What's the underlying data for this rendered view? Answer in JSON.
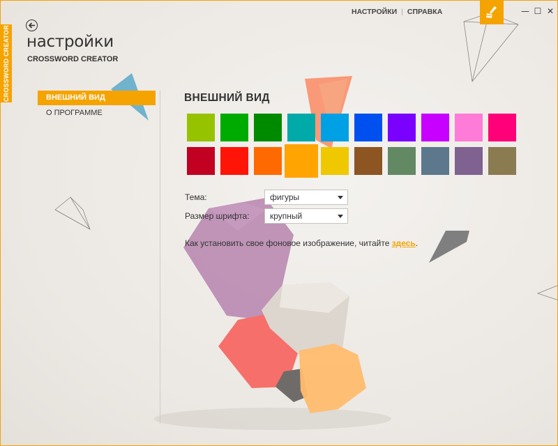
{
  "side_tab": {
    "label": "CROSSWORD CREATOR"
  },
  "top_links": {
    "settings": "НАСТРОЙКИ",
    "help": "СПРАВКА"
  },
  "window_controls": {
    "minimize": "—",
    "maximize": "☐",
    "close": "✕"
  },
  "header": {
    "title": "настройки",
    "subtitle": "CROSSWORD CREATOR"
  },
  "nav": {
    "items": [
      {
        "label": "ВНЕШНИЙ ВИД",
        "active": true
      },
      {
        "label": "О ПРОГРАММЕ",
        "active": false
      }
    ]
  },
  "main": {
    "section_title": "ВНЕШНИЙ ВИД",
    "selected_color": "#ffa400",
    "colors_row1": [
      "#96c300",
      "#00ab00",
      "#008a00",
      "#00aaa8",
      "#00a1e4",
      "#0050ef",
      "#7a00ff",
      "#c800ff",
      "#ff7bd8",
      "#ff0078"
    ],
    "colors_row2": [
      "#c10022",
      "#ff1508",
      "#ff6a00",
      "#ffa400",
      "#efc800",
      "#8c5522",
      "#628964",
      "#5d788c",
      "#7f6290",
      "#8b7b51"
    ],
    "theme": {
      "label": "Тема:",
      "value": "фигуры"
    },
    "font_size": {
      "label": "Размер шрифта:",
      "value": "крупный"
    },
    "info": {
      "text": "Как установить свое фоновое изображение, читайте ",
      "link": "здесь",
      "suffix": "."
    }
  },
  "accent_color": "#f5a300"
}
